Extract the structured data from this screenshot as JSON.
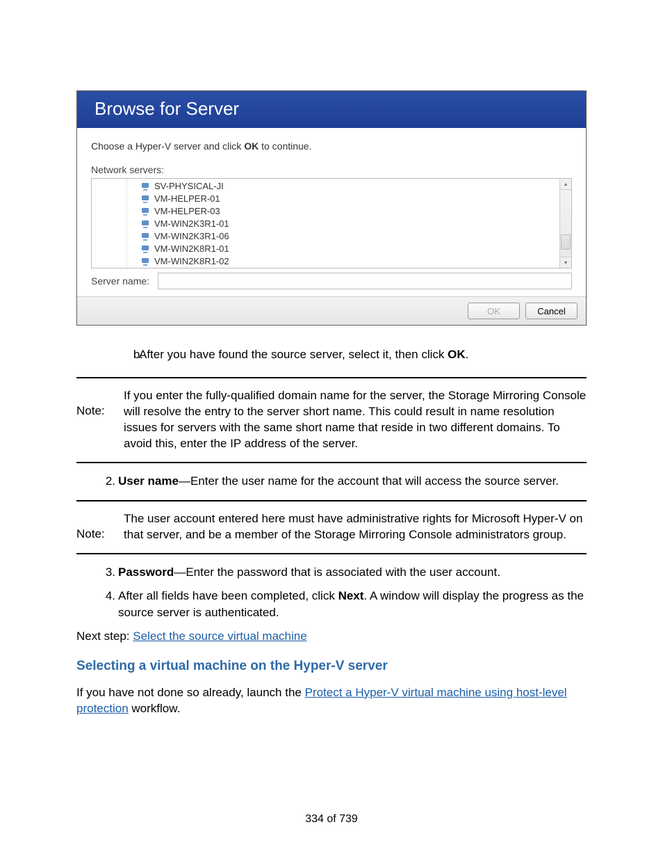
{
  "dialog": {
    "title": "Browse for Server",
    "instruction_pre": "Choose a Hyper-V server and click ",
    "instruction_bold": "OK",
    "instruction_post": " to continue.",
    "servers_label": "Network servers:",
    "servers": [
      "SV-PHYSICAL-JI",
      "VM-HELPER-01",
      "VM-HELPER-03",
      "VM-WIN2K3R1-01",
      "VM-WIN2K3R1-06",
      "VM-WIN2K8R1-01",
      "VM-WIN2K8R1-02"
    ],
    "server_name_label": "Server name:",
    "server_name_value": "",
    "ok_label": "OK",
    "cancel_label": "Cancel"
  },
  "step_b": {
    "marker": "b.",
    "text_pre": "After you have found the source server, select it, then click ",
    "text_bold": "OK",
    "text_post": "."
  },
  "note1": {
    "label": "Note:",
    "text": "If you enter the fully-qualified domain name for the server, the Storage Mirroring Console will resolve the entry to the server short name. This could result in name resolution issues for servers with the same short name that reside in two different domains. To avoid this, enter the IP address of the server."
  },
  "step2": {
    "marker": "2.",
    "bold": "User name",
    "dash": "—Enter the user name for the account that will access the source server."
  },
  "note2": {
    "label": "Note:",
    "text": "The user account entered here must have administrative rights for Microsoft Hyper-V on that server, and be a member of the Storage Mirroring Console administrators group."
  },
  "step3": {
    "marker": "3.",
    "bold": "Password",
    "dash": "—Enter the password that is associated with the user account."
  },
  "step4": {
    "marker": "4.",
    "pre": "After all fields have been completed, click ",
    "bold": "Next",
    "post": ". A window will display the progress as the source server is authenticated."
  },
  "next_step": {
    "pre": "Next step: ",
    "link": "Select the source virtual machine"
  },
  "heading": "Selecting a virtual machine on the Hyper-V server",
  "intro": {
    "pre": "If you have not done so already, launch the  ",
    "link": "Protect a Hyper-V virtual machine using host-level protection",
    "post": " workflow."
  },
  "page_footer": "334 of 739"
}
